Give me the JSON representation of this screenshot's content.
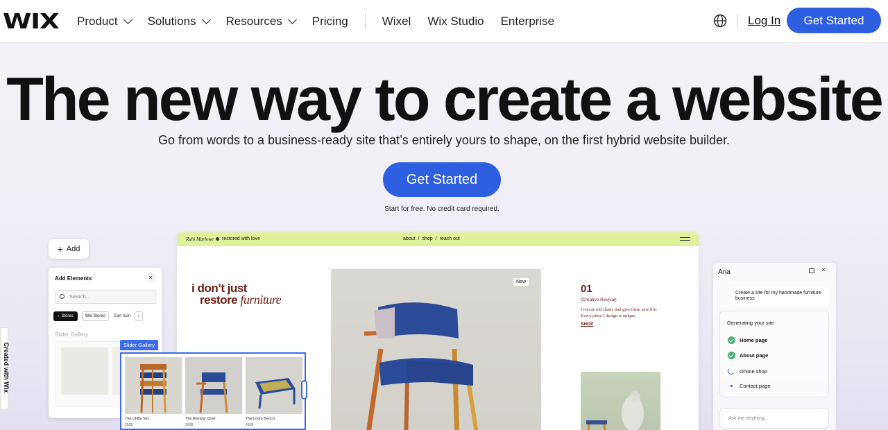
{
  "header": {
    "logo": "WIX",
    "nav": [
      {
        "label": "Product",
        "dropdown": true
      },
      {
        "label": "Solutions",
        "dropdown": true
      },
      {
        "label": "Resources",
        "dropdown": true
      },
      {
        "label": "Pricing",
        "dropdown": false
      }
    ],
    "nav_secondary": [
      "Wixel",
      "Wix Studio",
      "Enterprise"
    ],
    "login_label": "Log In",
    "cta_label": "Get Started"
  },
  "hero": {
    "title": "The new way to create a website",
    "subtitle": "Go from words to a business-ready site that’s entirely yours to shape, on the first hybrid website builder.",
    "cta_label": "Get Started",
    "note": "Start for free. No credit card required."
  },
  "side_tab": "Created with Wix",
  "editor": {
    "add_label": "Add",
    "panel_title": "Add Elements",
    "close_glyph": "×",
    "search_placeholder": "Search...",
    "chips": {
      "back": "Stores",
      "active": "Wix Stores",
      "next": "Cart Icon",
      "more": "›"
    },
    "section_label": "Slider Gallery",
    "selection_label": "Slider Gallery",
    "gallery": [
      {
        "name": "The Utility Set",
        "price": "260$"
      },
      {
        "name": "The Revival Chair",
        "price": "300$"
      },
      {
        "name": "The Loom Bench",
        "price": "430$"
      }
    ]
  },
  "site": {
    "brand": "Ruhi Marlowe",
    "tagline": "restored with love",
    "links": [
      "about",
      "shop",
      "reach out"
    ],
    "link_sep": "/",
    "headline_1": "i don’t just",
    "headline_2": "restore",
    "headline_3": "furniture",
    "badge": "New",
    "number": "01",
    "caption": "(Creative Revival)",
    "description": "I rescue old chairs and give them new life. Every piece I design is unique.",
    "shop_label": "SHOP"
  },
  "aria": {
    "title": "Aria",
    "close_glyph": "×",
    "message": "Create a site for my handmade furniture business",
    "generating_title": "Generating your site",
    "steps": [
      {
        "label": "Home page",
        "status": "done"
      },
      {
        "label": "About page",
        "status": "done"
      },
      {
        "label": "Online shop",
        "status": "in-progress"
      },
      {
        "label": "Contact page",
        "status": "pending"
      }
    ],
    "input_placeholder": "Ask me anything..."
  },
  "colors": {
    "primary": "#2f5fe1",
    "site_bar": "#dff19a",
    "site_text": "#6b1b14",
    "done_check": "#4caf7a"
  }
}
